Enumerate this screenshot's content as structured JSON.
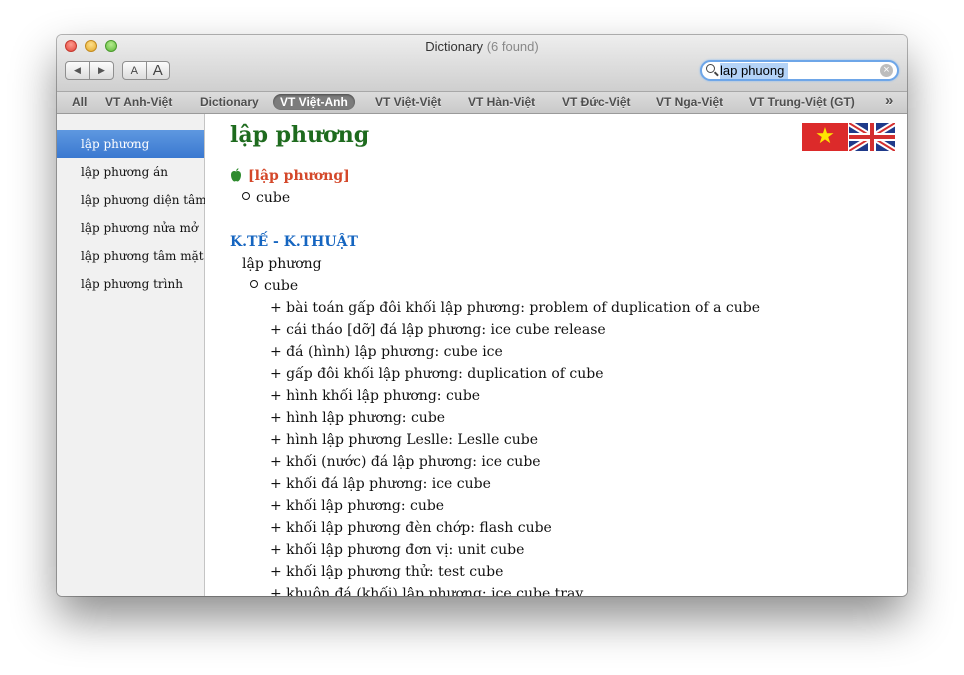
{
  "window": {
    "app": "Dictionary",
    "found_count": "(6 found)"
  },
  "toolbar": {
    "back": "◀",
    "forward": "▶",
    "font_smaller": "A",
    "font_larger": "A"
  },
  "search": {
    "value": "lap phuong"
  },
  "tabs": [
    {
      "label": "All"
    },
    {
      "label": "VT Anh-Việt"
    },
    {
      "label": "Dictionary"
    },
    {
      "label": "VT Việt-Anh",
      "active": true
    },
    {
      "label": "VT Việt-Việt"
    },
    {
      "label": "VT Hàn-Việt"
    },
    {
      "label": "VT Đức-Việt"
    },
    {
      "label": "VT Nga-Việt"
    },
    {
      "label": "VT Trung-Việt (GT)"
    },
    {
      "label": "»"
    }
  ],
  "sidebar": {
    "items": [
      {
        "label": "lập phương",
        "selected": true
      },
      {
        "label": "lập phương án"
      },
      {
        "label": "lập phương diện tâm"
      },
      {
        "label": "lập phương nửa mở"
      },
      {
        "label": "lập phương tâm mặt"
      },
      {
        "label": "lập phương trình"
      }
    ]
  },
  "entry": {
    "headword": "lập phương",
    "pronunciation": "[lập phương]",
    "general_sense": "cube",
    "section_label": "K.TẾ - K.THUẬT",
    "section_word": "lập phương",
    "section_sense": "cube",
    "examples": [
      "+ bài toán gấp đôi khối lập phương: problem of duplication of a cube",
      "+ cái tháo [dỡ] đá lập phương: ice cube release",
      "+ đá (hình) lập phương: cube ice",
      "+ gấp đôi khối lập phương: duplication of cube",
      "+ hình khối lập phương: cube",
      "+ hình lập phương: cube",
      "+ hình lập phương Leslle: Leslle cube",
      "+ khối (nước) đá lập phương: ice cube",
      "+ khối đá lập phương: ice cube",
      "+ khối lập phương: cube",
      "+ khối lập phương đèn chớp: flash cube",
      "+ khối lập phương đơn vị: unit cube",
      "+ khối lập phương thử: test cube",
      "+ khuôn đá (khối) lập phương: ice cube tray"
    ]
  },
  "flags": {
    "vn_star": "★"
  },
  "colors": {
    "headword": "#1e6b1e",
    "pronunciation": "#d4482a",
    "section": "#1565c0",
    "selection": "#3a78d0"
  }
}
